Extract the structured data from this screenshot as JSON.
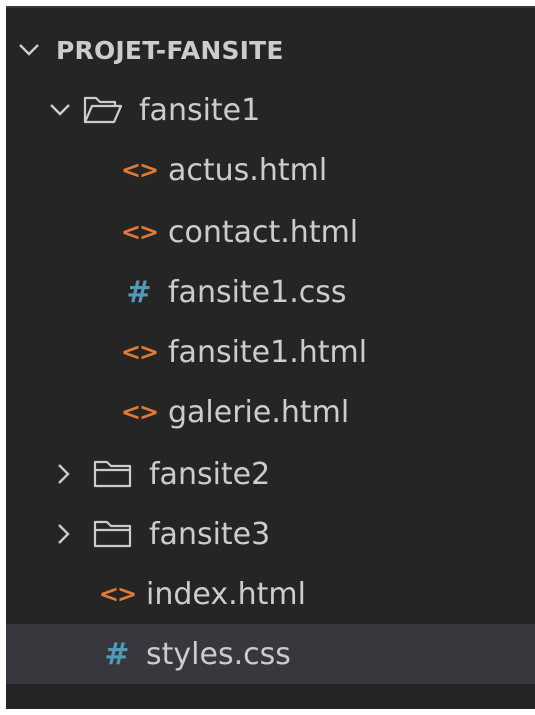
{
  "explorer": {
    "root": {
      "label": "PROJET-FANSITE",
      "expanded": true
    },
    "items": [
      {
        "label": "fansite1",
        "type": "folder",
        "expanded": true,
        "icon": "folder-open-icon"
      },
      {
        "label": "actus.html",
        "type": "html",
        "icon": "html-file-icon",
        "glyph": "<>"
      },
      {
        "label": "contact.html",
        "type": "html",
        "icon": "html-file-icon",
        "glyph": "<>"
      },
      {
        "label": "fansite1.css",
        "type": "css",
        "icon": "css-file-icon",
        "glyph": "#"
      },
      {
        "label": "fansite1.html",
        "type": "html",
        "icon": "html-file-icon",
        "glyph": "<>"
      },
      {
        "label": "galerie.html",
        "type": "html",
        "icon": "html-file-icon",
        "glyph": "<>"
      },
      {
        "label": "fansite2",
        "type": "folder",
        "expanded": false,
        "icon": "folder-icon"
      },
      {
        "label": "fansite3",
        "type": "folder",
        "expanded": false,
        "icon": "folder-icon"
      },
      {
        "label": "index.html",
        "type": "html",
        "icon": "html-file-icon",
        "glyph": "<>"
      },
      {
        "label": "styles.css",
        "type": "css",
        "icon": "css-file-icon",
        "glyph": "#",
        "selected": true
      }
    ]
  },
  "colors": {
    "background": "#252526",
    "selected_row": "#37373d",
    "text": "#cccccc",
    "html_icon": "#e37933",
    "css_icon": "#519aba"
  }
}
